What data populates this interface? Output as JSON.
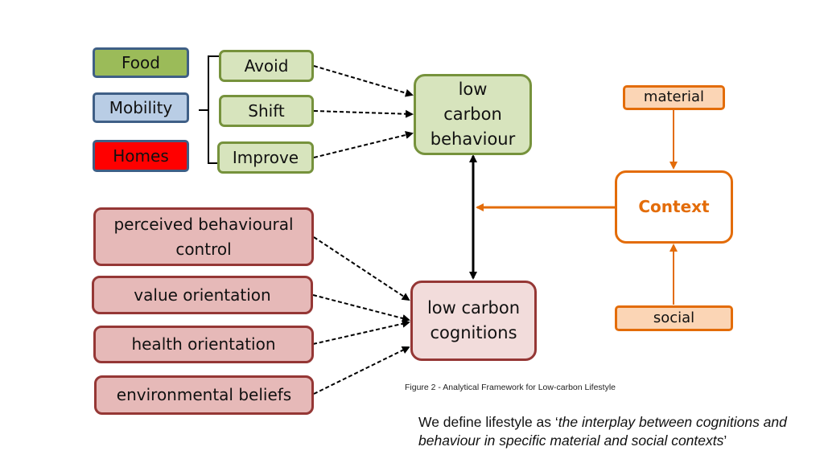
{
  "categories": [
    {
      "label": "Food",
      "fill": "#9bbb59"
    },
    {
      "label": "Mobility",
      "fill": "#b9cde5"
    },
    {
      "label": "Homes",
      "fill": "#ff0000"
    }
  ],
  "strategies": [
    "Avoid",
    "Shift",
    "Improve"
  ],
  "behaviour": {
    "label": "low carbon behaviour"
  },
  "cognition_factors": [
    "perceived behavioural control",
    "value orientation",
    "health orientation",
    "environmental beliefs"
  ],
  "cognitions": {
    "label": "low carbon cognitions"
  },
  "context": {
    "label": "Context",
    "material_label": "material",
    "social_label": "social",
    "accent_color": "#e36c09"
  },
  "caption": "Figure 2 - Analytical Framework for Low-carbon Lifestyle",
  "definition": {
    "prefix": "We define lifestyle as ‘",
    "quote": "the interplay between cognitions and behaviour in specific material and social contexts",
    "suffix": "’"
  }
}
